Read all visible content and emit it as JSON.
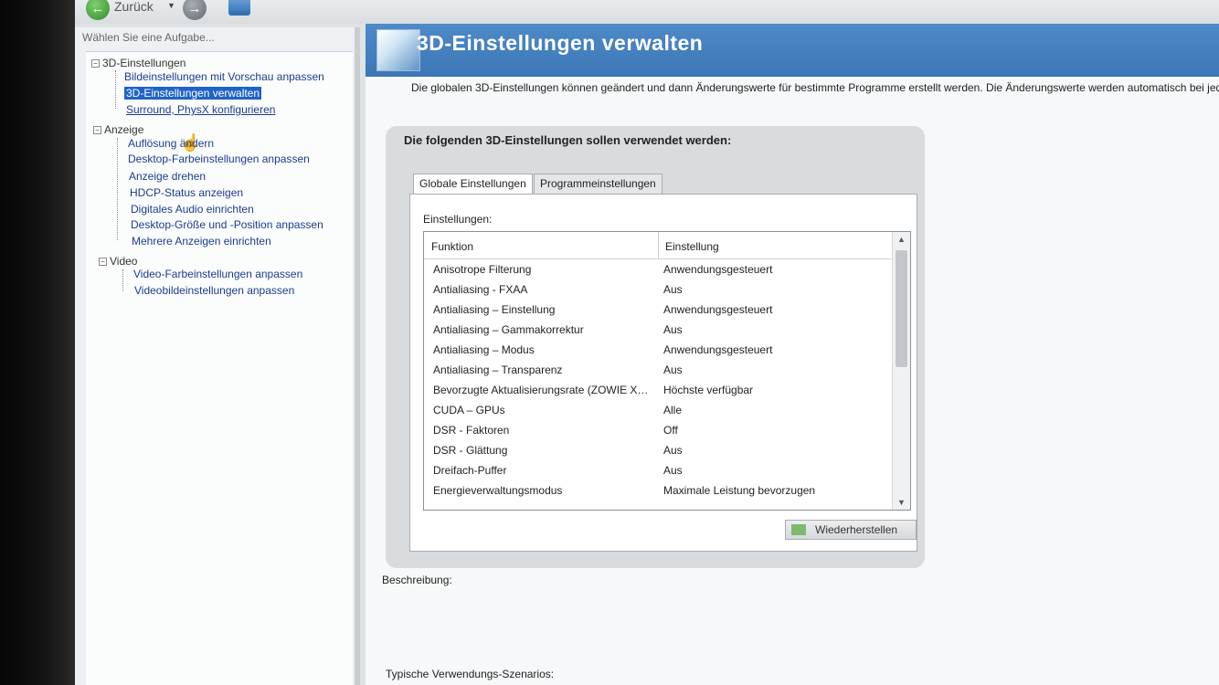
{
  "toolbar": {
    "back_label": "Zurück"
  },
  "sidebar": {
    "task_label": "Wählen Sie eine Aufgabe...",
    "categories": [
      {
        "label": "3D-Einstellungen",
        "items": [
          "Bildeinstellungen mit Vorschau anpassen",
          "3D-Einstellungen verwalten",
          "Surround, PhysX konfigurieren"
        ]
      },
      {
        "label": "Anzeige",
        "items": [
          "Auflösung ändern",
          "Desktop-Farbeinstellungen anpassen",
          "Anzeige drehen",
          "HDCP-Status anzeigen",
          "Digitales Audio einrichten",
          "Desktop-Größe und -Position anpassen",
          "Mehrere Anzeigen einrichten"
        ]
      },
      {
        "label": "Video",
        "items": [
          "Video-Farbeinstellungen anpassen",
          "Videobildeinstellungen anpassen"
        ]
      }
    ],
    "selected_item": "3D-Einstellungen verwalten"
  },
  "header": {
    "title": "3D-Einstellungen verwalten"
  },
  "intro": "Die globalen 3D-Einstellungen können geändert und dann Änderungswerte für bestimmte Programme erstellt werden. Die Änderungswerte werden automatisch bei jede",
  "group": {
    "title": "Die folgenden 3D-Einstellungen sollen verwendet werden:",
    "tabs": [
      "Globale Einstellungen",
      "Programmeinstellungen"
    ],
    "settings_label": "Einstellungen:",
    "columns": [
      "Funktion",
      "Einstellung"
    ],
    "rows": [
      [
        "Anisotrope Filterung",
        "Anwendungsgesteuert"
      ],
      [
        "Antialiasing - FXAA",
        "Aus"
      ],
      [
        "Antialiasing – Einstellung",
        "Anwendungsgesteuert"
      ],
      [
        "Antialiasing – Gammakorrektur",
        "Aus"
      ],
      [
        "Antialiasing – Modus",
        "Anwendungsgesteuert"
      ],
      [
        "Antialiasing – Transparenz",
        "Aus"
      ],
      [
        "Bevorzugte Aktualisierungsrate (ZOWIE X…",
        "Höchste verfügbar"
      ],
      [
        "CUDA – GPUs",
        "Alle"
      ],
      [
        "DSR - Faktoren",
        "Off"
      ],
      [
        "DSR - Glättung",
        "Aus"
      ],
      [
        "Dreifach-Puffer",
        "Aus"
      ],
      [
        "Energieverwaltungsmodus",
        "Maximale Leistung bevorzugen"
      ]
    ],
    "restore_label": "Wiederherstellen"
  },
  "description_label": "Beschreibung:",
  "usage_label": "Typische Verwendungs-Szenarios:"
}
